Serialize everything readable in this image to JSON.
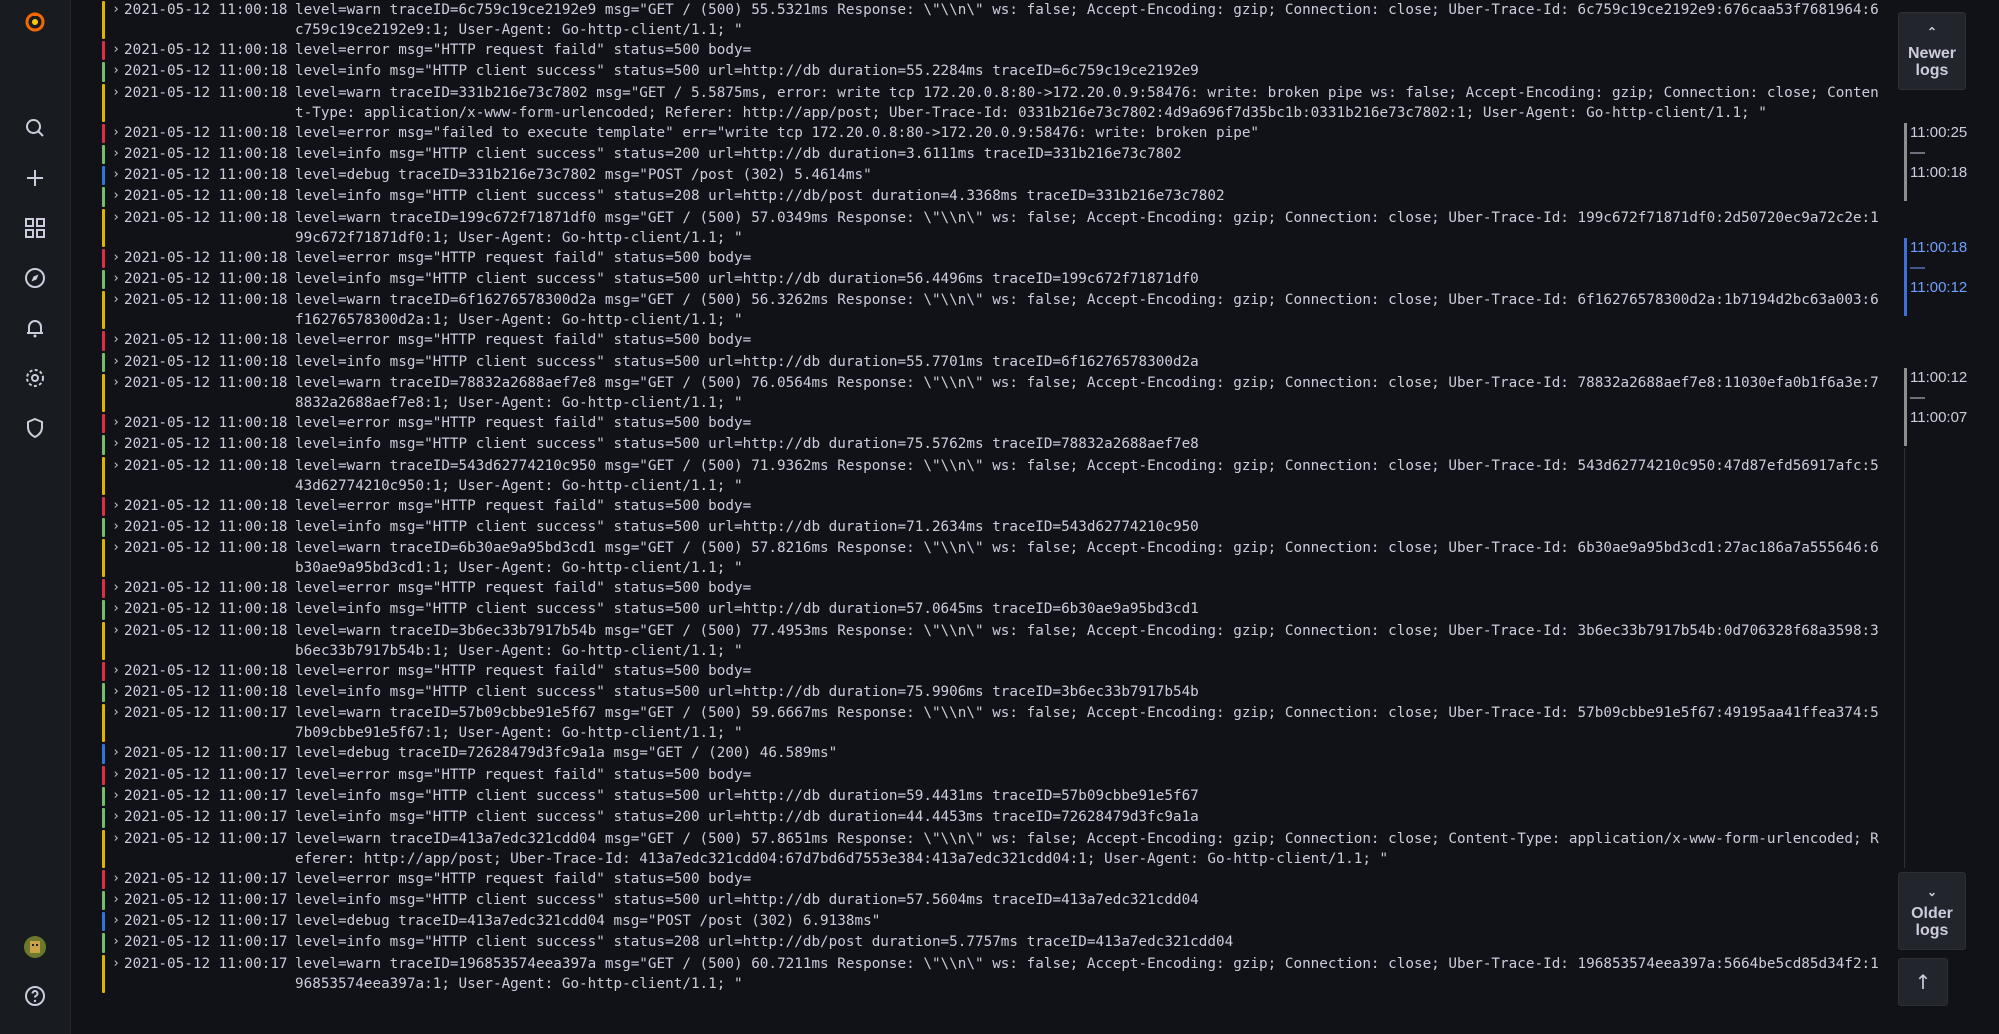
{
  "sidebar": {
    "items": [
      {
        "name": "grafana-logo-icon"
      },
      {
        "name": "search-icon"
      },
      {
        "name": "plus-icon"
      },
      {
        "name": "dashboards-icon"
      },
      {
        "name": "explore-icon"
      },
      {
        "name": "alerting-bell-icon"
      },
      {
        "name": "configuration-gear-icon"
      },
      {
        "name": "server-admin-shield-icon"
      },
      {
        "name": "user-avatar"
      },
      {
        "name": "help-icon"
      }
    ]
  },
  "colors": {
    "warn": "#e0b400",
    "error": "#e02f44",
    "info": "#73bf69",
    "debug": "#3274d9"
  },
  "logs": [
    {
      "level": "warn",
      "ts": "2021-05-12 11:00:18",
      "msg": "level=warn traceID=6c759c19ce2192e9 msg=\"GET / (500) 55.5321ms Response: \\\"\\\\n\\\" ws: false; Accept-Encoding: gzip; Connection: close; Uber-Trace-Id: 6c759c19ce2192e9:676caa53f7681964:6c759c19ce2192e9:1; User-Agent: Go-http-client/1.1; \""
    },
    {
      "level": "error",
      "ts": "2021-05-12 11:00:18",
      "msg": "level=error msg=\"HTTP request faild\" status=500 body="
    },
    {
      "level": "info",
      "ts": "2021-05-12 11:00:18",
      "msg": "level=info msg=\"HTTP client success\" status=500 url=http://db duration=55.2284ms traceID=6c759c19ce2192e9"
    },
    {
      "level": "warn",
      "ts": "2021-05-12 11:00:18",
      "msg": "level=warn traceID=331b216e73c7802 msg=\"GET / 5.5875ms, error: write tcp 172.20.0.8:80->172.20.0.9:58476: write: broken pipe ws: false; Accept-Encoding: gzip; Connection: close; Content-Type: application/x-www-form-urlencoded; Referer: http://app/post; Uber-Trace-Id: 0331b216e73c7802:4d9a696f7d35bc1b:0331b216e73c7802:1; User-Agent: Go-http-client/1.1; \""
    },
    {
      "level": "error",
      "ts": "2021-05-12 11:00:18",
      "msg": "level=error msg=\"failed to execute template\" err=\"write tcp 172.20.0.8:80->172.20.0.9:58476: write: broken pipe\""
    },
    {
      "level": "info",
      "ts": "2021-05-12 11:00:18",
      "msg": "level=info msg=\"HTTP client success\" status=200 url=http://db duration=3.6111ms traceID=331b216e73c7802"
    },
    {
      "level": "debug",
      "ts": "2021-05-12 11:00:18",
      "msg": "level=debug traceID=331b216e73c7802 msg=\"POST /post (302) 5.4614ms\""
    },
    {
      "level": "info",
      "ts": "2021-05-12 11:00:18",
      "msg": "level=info msg=\"HTTP client success\" status=208 url=http://db/post duration=4.3368ms traceID=331b216e73c7802"
    },
    {
      "level": "warn",
      "ts": "2021-05-12 11:00:18",
      "msg": "level=warn traceID=199c672f71871df0 msg=\"GET / (500) 57.0349ms Response: \\\"\\\\n\\\" ws: false; Accept-Encoding: gzip; Connection: close; Uber-Trace-Id: 199c672f71871df0:2d50720ec9a72c2e:199c672f71871df0:1; User-Agent: Go-http-client/1.1; \""
    },
    {
      "level": "error",
      "ts": "2021-05-12 11:00:18",
      "msg": "level=error msg=\"HTTP request faild\" status=500 body="
    },
    {
      "level": "info",
      "ts": "2021-05-12 11:00:18",
      "msg": "level=info msg=\"HTTP client success\" status=500 url=http://db duration=56.4496ms traceID=199c672f71871df0"
    },
    {
      "level": "warn",
      "ts": "2021-05-12 11:00:18",
      "msg": "level=warn traceID=6f16276578300d2a msg=\"GET / (500) 56.3262ms Response: \\\"\\\\n\\\" ws: false; Accept-Encoding: gzip; Connection: close; Uber-Trace-Id: 6f16276578300d2a:1b7194d2bc63a003:6f16276578300d2a:1; User-Agent: Go-http-client/1.1; \""
    },
    {
      "level": "error",
      "ts": "2021-05-12 11:00:18",
      "msg": "level=error msg=\"HTTP request faild\" status=500 body="
    },
    {
      "level": "info",
      "ts": "2021-05-12 11:00:18",
      "msg": "level=info msg=\"HTTP client success\" status=500 url=http://db duration=55.7701ms traceID=6f16276578300d2a"
    },
    {
      "level": "warn",
      "ts": "2021-05-12 11:00:18",
      "msg": "level=warn traceID=78832a2688aef7e8 msg=\"GET / (500) 76.0564ms Response: \\\"\\\\n\\\" ws: false; Accept-Encoding: gzip; Connection: close; Uber-Trace-Id: 78832a2688aef7e8:11030efa0b1f6a3e:78832a2688aef7e8:1; User-Agent: Go-http-client/1.1; \""
    },
    {
      "level": "error",
      "ts": "2021-05-12 11:00:18",
      "msg": "level=error msg=\"HTTP request faild\" status=500 body="
    },
    {
      "level": "info",
      "ts": "2021-05-12 11:00:18",
      "msg": "level=info msg=\"HTTP client success\" status=500 url=http://db duration=75.5762ms traceID=78832a2688aef7e8"
    },
    {
      "level": "warn",
      "ts": "2021-05-12 11:00:18",
      "msg": "level=warn traceID=543d62774210c950 msg=\"GET / (500) 71.9362ms Response: \\\"\\\\n\\\" ws: false; Accept-Encoding: gzip; Connection: close; Uber-Trace-Id: 543d62774210c950:47d87efd56917afc:543d62774210c950:1; User-Agent: Go-http-client/1.1; \""
    },
    {
      "level": "error",
      "ts": "2021-05-12 11:00:18",
      "msg": "level=error msg=\"HTTP request faild\" status=500 body="
    },
    {
      "level": "info",
      "ts": "2021-05-12 11:00:18",
      "msg": "level=info msg=\"HTTP client success\" status=500 url=http://db duration=71.2634ms traceID=543d62774210c950"
    },
    {
      "level": "warn",
      "ts": "2021-05-12 11:00:18",
      "msg": "level=warn traceID=6b30ae9a95bd3cd1 msg=\"GET / (500) 57.8216ms Response: \\\"\\\\n\\\" ws: false; Accept-Encoding: gzip; Connection: close; Uber-Trace-Id: 6b30ae9a95bd3cd1:27ac186a7a555646:6b30ae9a95bd3cd1:1; User-Agent: Go-http-client/1.1; \""
    },
    {
      "level": "error",
      "ts": "2021-05-12 11:00:18",
      "msg": "level=error msg=\"HTTP request faild\" status=500 body="
    },
    {
      "level": "info",
      "ts": "2021-05-12 11:00:18",
      "msg": "level=info msg=\"HTTP client success\" status=500 url=http://db duration=57.0645ms traceID=6b30ae9a95bd3cd1"
    },
    {
      "level": "warn",
      "ts": "2021-05-12 11:00:18",
      "msg": "level=warn traceID=3b6ec33b7917b54b msg=\"GET / (500) 77.4953ms Response: \\\"\\\\n\\\" ws: false; Accept-Encoding: gzip; Connection: close; Uber-Trace-Id: 3b6ec33b7917b54b:0d706328f68a3598:3b6ec33b7917b54b:1; User-Agent: Go-http-client/1.1; \""
    },
    {
      "level": "error",
      "ts": "2021-05-12 11:00:18",
      "msg": "level=error msg=\"HTTP request faild\" status=500 body="
    },
    {
      "level": "info",
      "ts": "2021-05-12 11:00:18",
      "msg": "level=info msg=\"HTTP client success\" status=500 url=http://db duration=75.9906ms traceID=3b6ec33b7917b54b"
    },
    {
      "level": "warn",
      "ts": "2021-05-12 11:00:17",
      "msg": "level=warn traceID=57b09cbbe91e5f67 msg=\"GET / (500) 59.6667ms Response: \\\"\\\\n\\\" ws: false; Accept-Encoding: gzip; Connection: close; Uber-Trace-Id: 57b09cbbe91e5f67:49195aa41ffea374:57b09cbbe91e5f67:1; User-Agent: Go-http-client/1.1; \""
    },
    {
      "level": "debug",
      "ts": "2021-05-12 11:00:17",
      "msg": "level=debug traceID=72628479d3fc9a1a msg=\"GET / (200) 46.589ms\""
    },
    {
      "level": "error",
      "ts": "2021-05-12 11:00:17",
      "msg": "level=error msg=\"HTTP request faild\" status=500 body="
    },
    {
      "level": "info",
      "ts": "2021-05-12 11:00:17",
      "msg": "level=info msg=\"HTTP client success\" status=500 url=http://db duration=59.4431ms traceID=57b09cbbe91e5f67"
    },
    {
      "level": "info",
      "ts": "2021-05-12 11:00:17",
      "msg": "level=info msg=\"HTTP client success\" status=200 url=http://db duration=44.4453ms traceID=72628479d3fc9a1a"
    },
    {
      "level": "warn",
      "ts": "2021-05-12 11:00:17",
      "msg": "level=warn traceID=413a7edc321cdd04 msg=\"GET / (500) 57.8651ms Response: \\\"\\\\n\\\" ws: false; Accept-Encoding: gzip; Connection: close; Content-Type: application/x-www-form-urlencoded; Referer: http://app/post; Uber-Trace-Id: 413a7edc321cdd04:67d7bd6d7553e384:413a7edc321cdd04:1; User-Agent: Go-http-client/1.1; \""
    },
    {
      "level": "error",
      "ts": "2021-05-12 11:00:17",
      "msg": "level=error msg=\"HTTP request faild\" status=500 body="
    },
    {
      "level": "info",
      "ts": "2021-05-12 11:00:17",
      "msg": "level=info msg=\"HTTP client success\" status=500 url=http://db duration=57.5604ms traceID=413a7edc321cdd04"
    },
    {
      "level": "debug",
      "ts": "2021-05-12 11:00:17",
      "msg": "level=debug traceID=413a7edc321cdd04 msg=\"POST /post (302) 6.9138ms\""
    },
    {
      "level": "info",
      "ts": "2021-05-12 11:00:17",
      "msg": "level=info msg=\"HTTP client success\" status=208 url=http://db/post duration=5.7757ms traceID=413a7edc321cdd04"
    },
    {
      "level": "warn",
      "ts": "2021-05-12 11:00:17",
      "msg": "level=warn traceID=196853574eea397a msg=\"GET / (500) 60.7211ms Response: \\\"\\\\n\\\" ws: false; Accept-Encoding: gzip; Connection: close; Uber-Trace-Id: 196853574eea397a:5664be5cd85d34f2:196853574eea397a:1; User-Agent: Go-http-client/1.1; \""
    }
  ],
  "right_pane": {
    "newer_caret": "⌃",
    "newer_label_1": "Newer",
    "newer_label_2": "logs",
    "ranges": [
      {
        "start": "11:00:25",
        "dash": "—",
        "end": "11:00:18",
        "active": false
      },
      {
        "start": "11:00:18",
        "dash": "—",
        "end": "11:00:12",
        "active": true
      },
      {
        "start": "11:00:12",
        "dash": "—",
        "end": "11:00:07",
        "active": false
      }
    ],
    "older_caret": "⌄",
    "older_label_1": "Older",
    "older_label_2": "logs",
    "scroll_top_icon": "↑"
  }
}
